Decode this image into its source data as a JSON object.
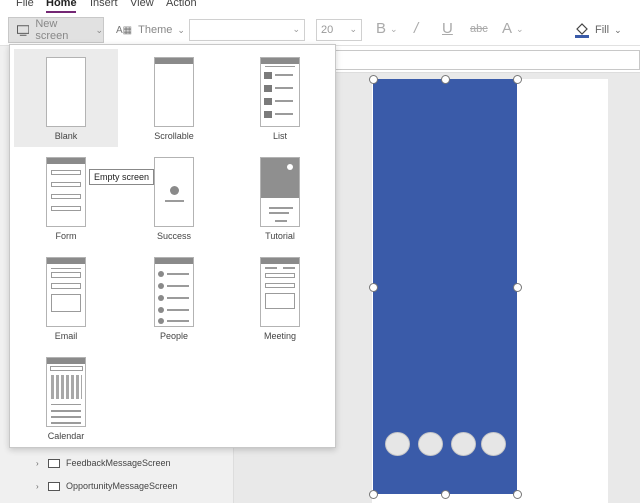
{
  "menu": {
    "items": [
      "File",
      "Home",
      "Insert",
      "View",
      "Action"
    ],
    "active": "Home",
    "accent": "#742774"
  },
  "toolbar": {
    "new_screen_label": "New screen",
    "theme_label": "Theme",
    "font_size": "20",
    "fill_label": "Fill",
    "icons": [
      "new-screen-icon",
      "theme-icon",
      "bold-icon",
      "italic-icon",
      "underline-icon",
      "strikethrough-icon",
      "font-color-icon",
      "fill-icon"
    ]
  },
  "dropdown": {
    "tooltip": "Empty screen",
    "templates": [
      {
        "label": "Blank"
      },
      {
        "label": "Scrollable"
      },
      {
        "label": "List"
      },
      {
        "label": "Form"
      },
      {
        "label": "Success"
      },
      {
        "label": "Tutorial"
      },
      {
        "label": "Email"
      },
      {
        "label": "People"
      },
      {
        "label": "Meeting"
      },
      {
        "label": "Calendar"
      }
    ]
  },
  "tree": {
    "items": [
      {
        "label": "FeedbackMessageScreen"
      },
      {
        "label": "OpportunityMessageScreen"
      }
    ]
  },
  "canvas": {
    "rect_color": "#3a5ba9"
  }
}
